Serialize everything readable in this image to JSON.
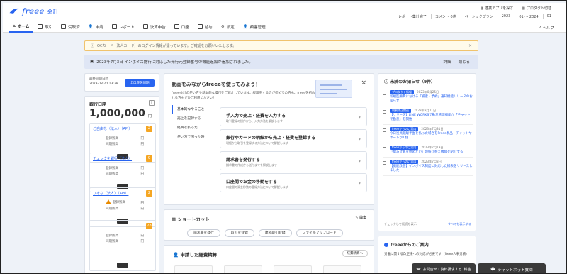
{
  "app": {
    "logo": "freee",
    "logo_sub": "会計"
  },
  "header": {
    "links": [
      "連携アプリを探す",
      "プロダクト切替"
    ],
    "info": [
      "レポート集計完了",
      "コメント 0件",
      "ベーシックプラン",
      "2023",
      "01 〜 2024",
      "01"
    ]
  },
  "nav": {
    "items": [
      "ホーム",
      "取引",
      "受取済",
      "申請",
      "レポート",
      "決算申告",
      "口座",
      "給与",
      "設定",
      "顧客管理"
    ],
    "help": "ヘルプ"
  },
  "alert": {
    "text": "OCカード（法人カード）のログイン情報が違っています。ご確認をお願いいたします。"
  },
  "notice": {
    "text": "2023年7月3日 インボイス施行に対応した発行元登録番号の機能追加が追加されました。",
    "detail": "詳細",
    "close": "閉じる"
  },
  "date_card": {
    "label": "最終同期日時",
    "value": "2023-08-20 13:38",
    "button": "全口座を同期"
  },
  "bank": {
    "title": "銀行口座",
    "total": "1,000,000",
    "unit": "円",
    "accounts": [
      {
        "name": "ご自由な（法人）（API）",
        "badge": "2",
        "row1": "登録残高",
        "row2": "同期残高",
        "v1": "円",
        "v2": "円"
      },
      {
        "name": "チェックを銀行（法人）",
        "badge": "9",
        "row1": "登録残高",
        "row2": "同期残高",
        "v1": "円",
        "v2": "円"
      },
      {
        "name": "りそな（法人）（API）",
        "badge": "2",
        "row1": "登録残高",
        "row2": "同期残高",
        "v1": "円",
        "v2": "円"
      },
      {
        "name": "",
        "badge": "28",
        "row1": "登録残高",
        "row2": "同期残高",
        "v1": "円",
        "v2": "円"
      }
    ]
  },
  "video": {
    "title": "動画をみながらfreeeを使ってみよう！",
    "desc": "freee会計の使い方や基本的な操作をご紹介しています。経理をするのが初めての方も、freeeを初めて使われる方もぜひご利用ください！",
    "tabs": [
      "基本的なやること",
      "売上を記録する",
      "経費を払った",
      "使い方で困った時"
    ],
    "items": [
      {
        "title": "手入力で売上・経費を入力する",
        "desc": "取引登録の操作から、入力方法を解説します"
      },
      {
        "title": "銀行やカードの明細から売上・経費を登録する",
        "desc": "明細から取引を登録する方法について解説します"
      },
      {
        "title": "請求書を発行する",
        "desc": "請求書の作成から送付までを解説します"
      },
      {
        "title": "口座間でお金の移動をする",
        "desc": "口座間の資金移動の登録方法について解説します"
      }
    ]
  },
  "shortcut": {
    "title": "ショートカット",
    "edit": "編集",
    "buttons": [
      "請求書を発行",
      "取引を登録",
      "連続取引登録",
      "ファイルアップロード"
    ]
  },
  "expense": {
    "title": "申請した経費精算",
    "button": "経費精算へ"
  },
  "news": {
    "title": "未読のお知らせ（9件）",
    "items": [
      {
        "tag": "プロダクト情報",
        "date": "2023年8月25日",
        "text": "新規医療費における「検索・予約」通知機能リリースのお知らせ"
      },
      {
        "tag": "税制改正関連",
        "date": "2023年8月21日",
        "text": "【リリース】LINE WORKSで勤怠管理機能が「チャットで勤怠」を開始"
      },
      {
        "tag": "freeeからのご案内",
        "date": "2023年7月31日",
        "text": "今日役員報酬手当を払った場合をFreee製品・チャットサポートが1割"
      },
      {
        "tag": "freeeからのご案内",
        "date": "2023年7月19日",
        "text": "「給与計算を始めたい」の振り替え機能を紹介する"
      },
      {
        "tag": "freeeからのご案内",
        "date": "2023年7月3日",
        "text": "【機能改善】インボイス制度に対応した帳表をリリースしました！"
      }
    ],
    "foot_left": "チェックして既読を表示",
    "foot_right": "すべてを表示する"
  },
  "info": {
    "title": "freeeからのご案内",
    "text": "労働に関する改正法への対応が必要です（freee人事労務）"
  },
  "chat": {
    "support": "お問合せ・資料請求する",
    "support_suffix": "料金",
    "bot": "チャットボット質問"
  },
  "colors": {
    "accent": "#2864f0",
    "warning": "#f5a623",
    "notice_bg": "#dfe6f5"
  }
}
